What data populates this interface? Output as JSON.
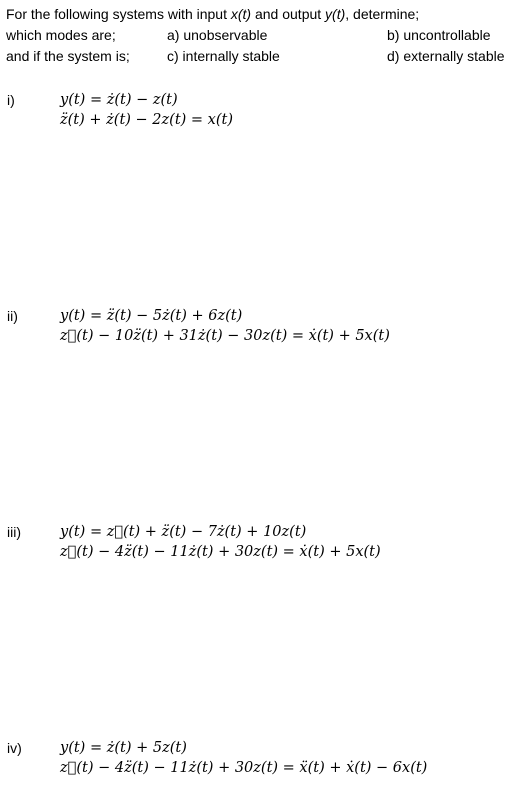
{
  "intro": {
    "line1_pre": "For the following systems with input ",
    "input_var": "x(t)",
    "line1_mid": " and output ",
    "output_var": "y(t)",
    "line1_post": ", determine;",
    "line2_lead": "which modes are;",
    "item_a": "a) unobservable",
    "item_b": "b) uncontrollable",
    "line3_lead": "and if the system is;",
    "item_c": "c) internally stable",
    "item_d": "d) externally stable"
  },
  "problems": [
    {
      "label": "i)",
      "output_eq": "y(t) = ż(t) − z(t)",
      "state_eq": "z̈(t) + ż(t) − 2z(t) = x(t)"
    },
    {
      "label": "ii)",
      "output_eq": "y(t) = z̈(t) − 5ż(t) + 6z(t)",
      "state_eq": "z⃛(t) − 10z̈(t) + 31ż(t) − 30z(t) = ẋ(t) + 5x(t)"
    },
    {
      "label": "iii)",
      "output_eq": "y(t) = z⃛(t) + z̈(t) − 7ż(t) + 10z(t)",
      "state_eq": "z⃛(t) − 4z̈(t) − 11ż(t) + 30z(t) = ẋ(t) + 5x(t)"
    },
    {
      "label": "iv)",
      "output_eq": "y(t) = ż(t) + 5z(t)",
      "state_eq": "z⃛(t) − 4z̈(t) − 11ż(t) + 30z(t) = ẍ(t) + ẋ(t) − 6x(t)"
    }
  ]
}
